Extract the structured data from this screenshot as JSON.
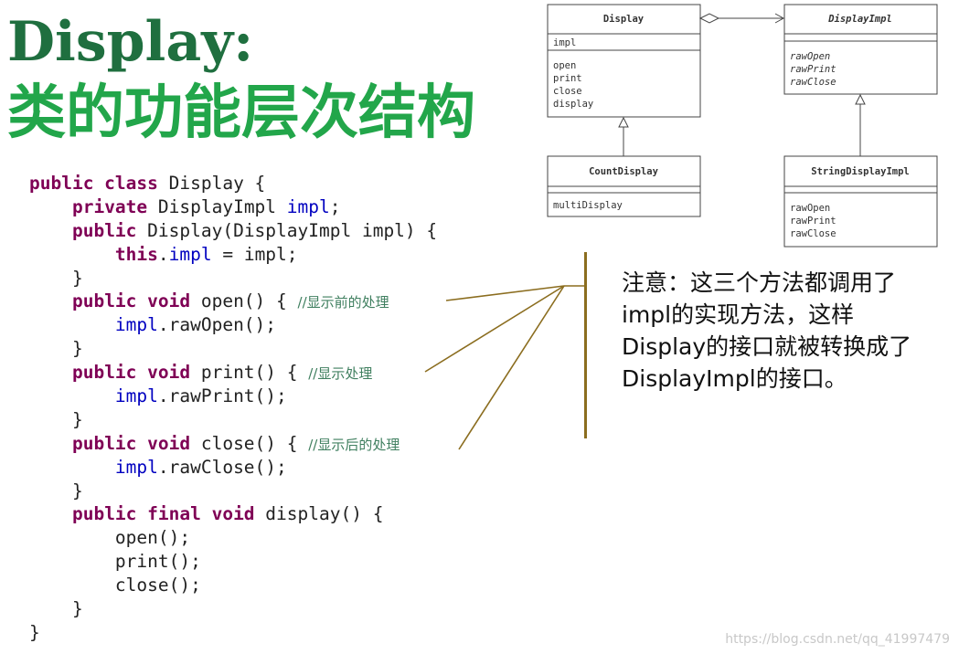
{
  "title": {
    "line1": "Display:",
    "line2": "类的功能层次结构"
  },
  "code": {
    "lines": [
      [
        {
          "t": "public class",
          "c": "kw"
        },
        {
          "t": " Display {",
          "c": ""
        }
      ],
      [
        {
          "t": "    ",
          "c": ""
        },
        {
          "t": "private",
          "c": "kw"
        },
        {
          "t": " DisplayImpl ",
          "c": ""
        },
        {
          "t": "impl",
          "c": "fld"
        },
        {
          "t": ";",
          "c": ""
        }
      ],
      [
        {
          "t": "    ",
          "c": ""
        },
        {
          "t": "public",
          "c": "kw"
        },
        {
          "t": " Display(DisplayImpl impl) {",
          "c": ""
        }
      ],
      [
        {
          "t": "        ",
          "c": ""
        },
        {
          "t": "this",
          "c": "kw"
        },
        {
          "t": ".",
          "c": ""
        },
        {
          "t": "impl",
          "c": "fld"
        },
        {
          "t": " = impl;",
          "c": ""
        }
      ],
      [
        {
          "t": "    }",
          "c": ""
        }
      ],
      [
        {
          "t": "    ",
          "c": ""
        },
        {
          "t": "public void",
          "c": "kw"
        },
        {
          "t": " open() { ",
          "c": ""
        },
        {
          "t": "//显示前的处理",
          "c": "cm"
        }
      ],
      [
        {
          "t": "        ",
          "c": ""
        },
        {
          "t": "impl",
          "c": "fld"
        },
        {
          "t": ".rawOpen();",
          "c": ""
        }
      ],
      [
        {
          "t": "    }",
          "c": ""
        }
      ],
      [
        {
          "t": "    ",
          "c": ""
        },
        {
          "t": "public void",
          "c": "kw"
        },
        {
          "t": " print() { ",
          "c": ""
        },
        {
          "t": "//显示处理",
          "c": "cm"
        }
      ],
      [
        {
          "t": "        ",
          "c": ""
        },
        {
          "t": "impl",
          "c": "fld"
        },
        {
          "t": ".rawPrint();",
          "c": ""
        }
      ],
      [
        {
          "t": "    }",
          "c": ""
        }
      ],
      [
        {
          "t": "    ",
          "c": ""
        },
        {
          "t": "public void",
          "c": "kw"
        },
        {
          "t": " close() { ",
          "c": ""
        },
        {
          "t": "//显示后的处理",
          "c": "cm"
        }
      ],
      [
        {
          "t": "        ",
          "c": ""
        },
        {
          "t": "impl",
          "c": "fld"
        },
        {
          "t": ".rawClose();",
          "c": ""
        }
      ],
      [
        {
          "t": "    }",
          "c": ""
        }
      ],
      [
        {
          "t": "    ",
          "c": ""
        },
        {
          "t": "public final void",
          "c": "kw"
        },
        {
          "t": " display() {",
          "c": ""
        }
      ],
      [
        {
          "t": "        open();",
          "c": ""
        }
      ],
      [
        {
          "t": "        print();",
          "c": ""
        }
      ],
      [
        {
          "t": "        close();",
          "c": ""
        }
      ],
      [
        {
          "t": "    }",
          "c": ""
        }
      ],
      [
        {
          "t": "}",
          "c": ""
        }
      ]
    ]
  },
  "uml": {
    "display": {
      "name": "Display",
      "fields": [
        "impl"
      ],
      "methods": [
        "open",
        "print",
        "close",
        "display"
      ]
    },
    "displayImpl": {
      "name": "DisplayImpl",
      "fields": [],
      "methods": [
        "rawOpen",
        "rawPrint",
        "rawClose"
      ]
    },
    "countDisplay": {
      "name": "CountDisplay",
      "fields": [],
      "methods": [
        "multiDisplay"
      ]
    },
    "stringDisplayImpl": {
      "name": "StringDisplayImpl",
      "fields": [],
      "methods": [
        "rawOpen",
        "rawPrint",
        "rawClose"
      ]
    }
  },
  "note": "注意：这三个方法都调用了impl的实现方法，这样Display的接口就被转换成了DisplayImpl的接口。",
  "watermark": "https://blog.csdn.net/qq_41997479",
  "colors": {
    "title_dark": "#1f6f3f",
    "title_green": "#22a64a",
    "keyword": "#7f0055",
    "field": "#0000c0",
    "comment": "#3f7f5f",
    "bracket": "#8b6d1f"
  }
}
